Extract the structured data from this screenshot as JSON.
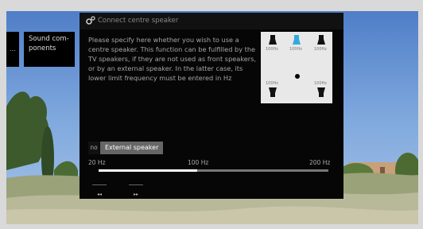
{
  "menu": {
    "left_item_label": "...",
    "sound_components_label": "Sound com-\nponents"
  },
  "dialog": {
    "title": "Connect centre speaker",
    "description": "Please specify here whether you wish to use a centre speaker. This function can be fulfilled by the TV speakers, if they are not used as front speakers, or by an external speaker. In the latter case, its lower limit frequency must be entered in Hz",
    "speaker_labels": {
      "front_left": "100Hz",
      "centre": "100Hz",
      "front_right": "100Hz",
      "rear_left": "100Hz",
      "rear_right": "100Hz"
    },
    "options": [
      {
        "label": "no",
        "selected": false
      },
      {
        "label": "External speaker",
        "selected": true
      }
    ],
    "frequency": {
      "min_label": "20 Hz",
      "mid_label": "100 Hz",
      "max_label": "200 Hz",
      "value_fraction": 0.43
    },
    "nav": {
      "back_label": "◂◂",
      "forward_label": "▸▸"
    }
  },
  "colors": {
    "dialog_bg": "#060606",
    "accent_centre_speaker": "#33aadd",
    "selected_option_bg": "#666666"
  }
}
